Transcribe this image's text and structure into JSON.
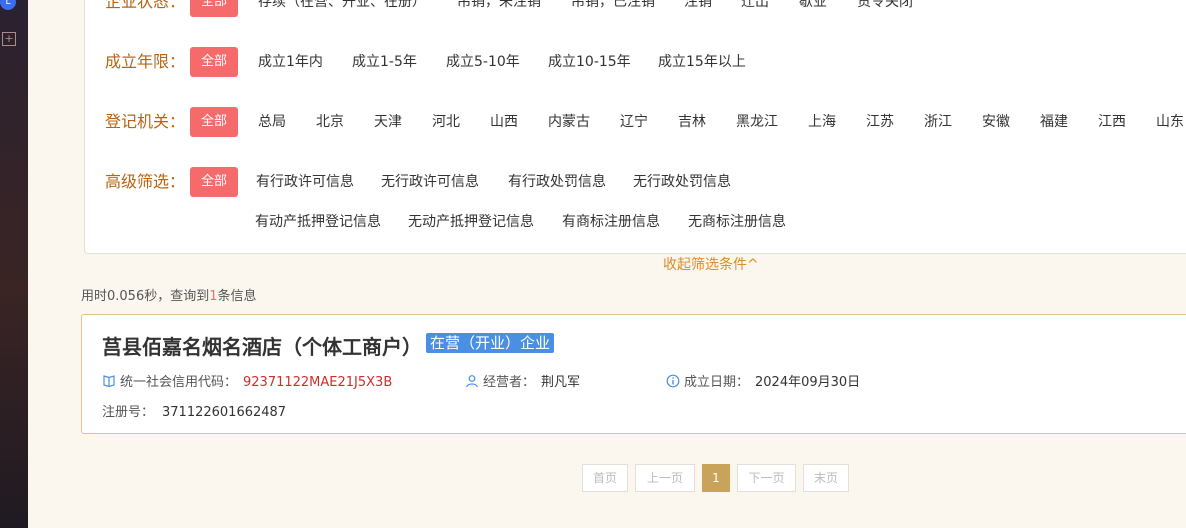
{
  "filters": {
    "status": {
      "label": "企业状态：",
      "all": "全部",
      "options": [
        "存续（在营、开业、在册）",
        "吊销，未注销",
        "吊销，已注销",
        "注销",
        "迁出",
        "歇业",
        "责令关闭"
      ]
    },
    "years": {
      "label": "成立年限：",
      "all": "全部",
      "options": [
        "成立1年内",
        "成立1-5年",
        "成立5-10年",
        "成立10-15年",
        "成立15年以上"
      ]
    },
    "authority": {
      "label": "登记机关：",
      "all": "全部",
      "options": [
        "总局",
        "北京",
        "天津",
        "河北",
        "山西",
        "内蒙古",
        "辽宁",
        "吉林",
        "黑龙江",
        "上海",
        "江苏",
        "浙江",
        "安徽",
        "福建",
        "江西",
        "山东"
      ]
    },
    "advanced": {
      "label": "高级筛选：",
      "all": "全部",
      "options_row1": [
        "有行政许可信息",
        "无行政许可信息",
        "有行政处罚信息",
        "无行政处罚信息"
      ],
      "options_row2": [
        "有动产抵押登记信息",
        "无动产抵押登记信息",
        "有商标注册信息",
        "无商标注册信息"
      ]
    },
    "collapse_label": "收起筛选条件^"
  },
  "result_info": {
    "prefix": "用时0.056秒，查询到",
    "count": "1",
    "suffix": "条信息"
  },
  "result": {
    "company_name": "莒县佰嘉名烟名酒店（个体工商户）",
    "status_tag": "在营（开业）企业",
    "credit_code_label": "统一社会信用代码：",
    "credit_code": "92371122MAE21J5X3B",
    "operator_label": "经营者：",
    "operator": "荆凡军",
    "established_label": "成立日期：",
    "established": "2024年09月30日",
    "reg_no_label": "注册号：",
    "reg_no": "371122601662487"
  },
  "pagination": {
    "first": "首页",
    "prev": "上一页",
    "current": "1",
    "next": "下一页",
    "last": "末页"
  },
  "colors": {
    "accent_red": "#f56a6a",
    "label_orange": "#b86412",
    "tag_blue": "#4a90e2",
    "page_gold": "#c9a35a"
  },
  "icons": [
    "notification-dot-icon",
    "add-box-icon",
    "book-icon",
    "user-icon",
    "info-icon"
  ]
}
